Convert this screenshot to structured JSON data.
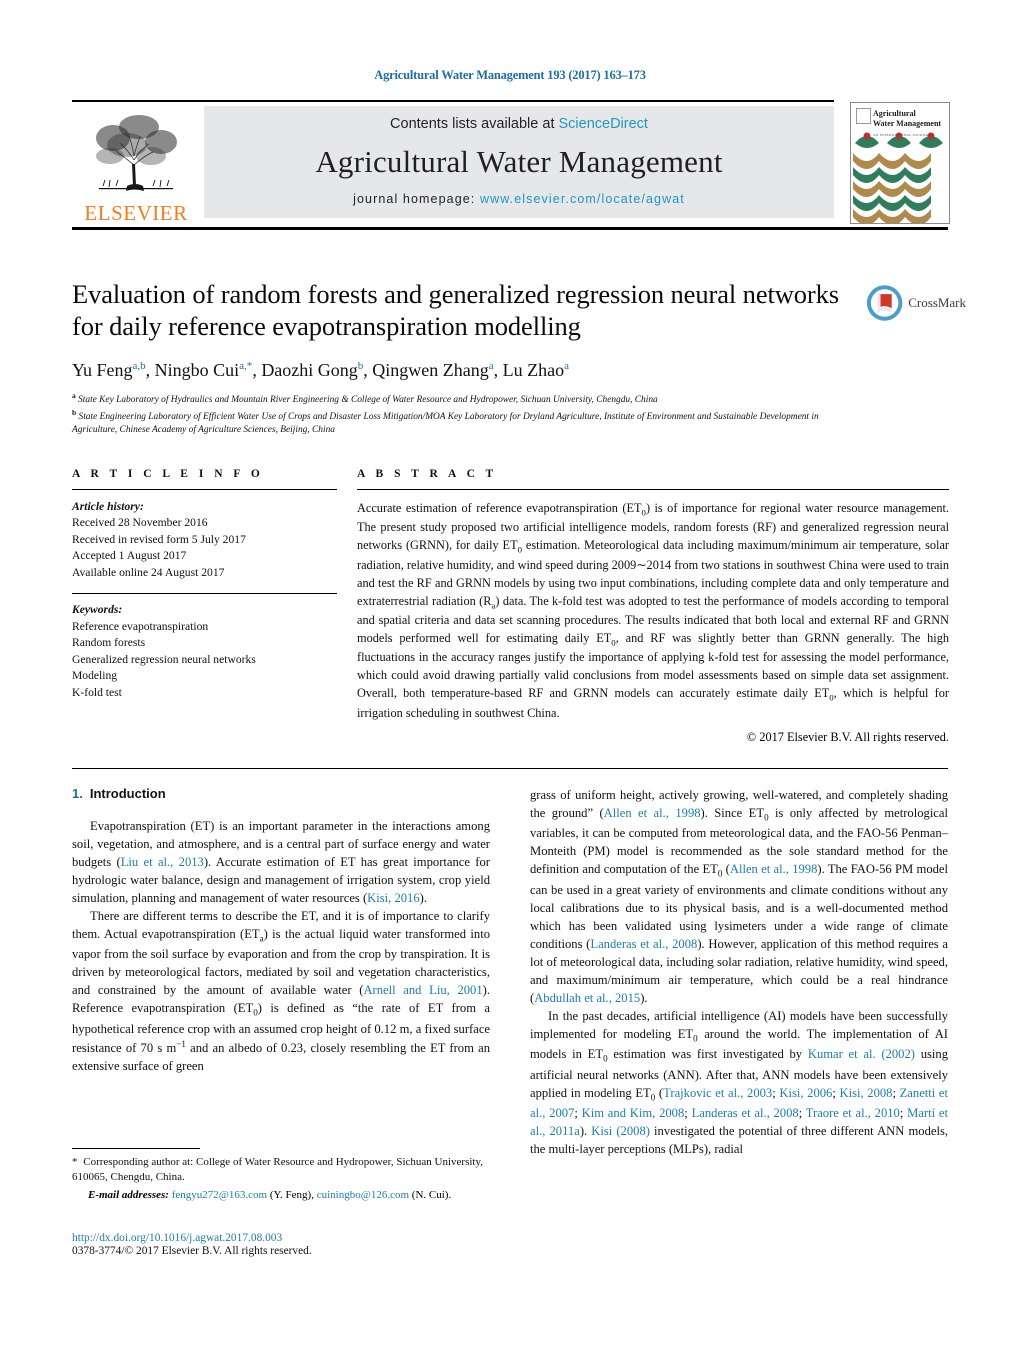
{
  "running_head": "Agricultural Water Management 193 (2017) 163–173",
  "masthead": {
    "contents_prefix": "Contents lists available at ",
    "sciencedirect": "ScienceDirect",
    "journal_title": "Agricultural Water Management",
    "homepage_prefix": "journal homepage: ",
    "homepage_url": "www.elsevier.com/locate/agwat",
    "publisher": "ELSEVIER",
    "cover_title_line1": "Agricultural",
    "cover_title_line2": "Water Management",
    "cover_subtitle": "AN INTERNATIONAL JOURNAL"
  },
  "crossmark": {
    "label": "CrossMark",
    "icon": "crossmark-icon"
  },
  "article": {
    "title": "Evaluation of random forests and generalized regression neural networks for daily reference evapotranspiration modelling",
    "authors_html": "Yu Feng<sup>a,b</sup>, Ningbo Cui<sup>a,*</sup>, Daozhi Gong<sup>b</sup>, Qingwen Zhang<sup>a</sup>, Lu Zhao<sup>a</sup>",
    "affiliation_a": "State Key Laboratory of Hydraulics and Mountain River Engineering & College of Water Resource and Hydropower, Sichuan University, Chengdu, China",
    "affiliation_b": "State Engineering Laboratory of Efficient Water Use of Crops and Disaster Loss Mitigation/MOA Key Laboratory for Dryland Agriculture, Institute of Environment and Sustainable Development in Agriculture, Chinese Academy of Agriculture Sciences, Beijing, China"
  },
  "article_info": {
    "heading": "A R T I C L E   I N F O",
    "history_label": "Article history:",
    "history": [
      "Received 28 November 2016",
      "Received in revised form 5 July 2017",
      "Accepted 1 August 2017",
      "Available online 24 August 2017"
    ],
    "keywords_label": "Keywords:",
    "keywords": [
      "Reference evapotranspiration",
      "Random forests",
      "Generalized regression neural networks",
      "Modeling",
      "K-fold test"
    ]
  },
  "abstract": {
    "heading": "A B S T R A C T",
    "body_html": "Accurate estimation of reference evapotranspiration (ET<sub>0</sub>) is of importance for regional water resource management. The present study proposed two artificial intelligence models, random forests (RF) and generalized regression neural networks (GRNN), for daily ET<sub>0</sub> estimation. Meteorological data including maximum/minimum air temperature, solar radiation, relative humidity, and wind speed during 2009&#8764;2014 from two stations in southwest China were used to train and test the RF and GRNN models by using two input combinations, including complete data and only temperature and extraterrestrial radiation (R<sub>a</sub>) data. The k-fold test was adopted to test the performance of models according to temporal and spatial criteria and data set scanning procedures. The results indicated that both local and external RF and GRNN models performed well for estimating daily ET<sub>0</sub>, and RF was slightly better than GRNN generally. The high fluctuations in the accuracy ranges justify the importance of applying k-fold test for assessing the model performance, which could avoid drawing partially valid conclusions from model assessments based on simple data set assignment. Overall, both temperature-based RF and GRNN models can accurately estimate daily ET<sub>0</sub>, which is helpful for irrigation scheduling in southwest China.",
    "copyright": "© 2017 Elsevier B.V. All rights reserved."
  },
  "introduction": {
    "number": "1.",
    "heading": "Introduction",
    "left_paragraphs_html": [
      "Evapotranspiration (ET) is an important parameter in the interactions among soil, vegetation, and atmosphere, and is a central part of surface energy and water budgets (<span class=\"ref\">Liu et al., 2013</span>). Accurate estimation of ET has great importance for hydrologic water balance, design and management of irrigation system, crop yield simulation, planning and management of water resources (<span class=\"ref\">Kisi, 2016</span>).",
      "There are different terms to describe the ET, and it is of importance to clarify them. Actual evapotranspiration (ET<sub>a</sub>) is the actual liquid water transformed into vapor from the soil surface by evaporation and from the crop by transpiration. It is driven by meteorological factors, mediated by soil and vegetation characteristics, and constrained by the amount of available water (<span class=\"ref\">Arnell and Liu, 2001</span>). Reference evapotranspiration (ET<sub>0</sub>) is defined as &#8220;the rate of ET from a hypothetical reference crop with an assumed crop height of 0.12 m, a fixed surface resistance of 70 s m<sup class=\"inl\">&#8722;1</sup> and an albedo of 0.23, closely resembling the ET from an extensive surface of green"
    ],
    "right_paragraphs_html": [
      "grass of uniform height, actively growing, well-watered, and completely shading the ground&#8221; (<span class=\"ref\">Allen et al., 1998</span>). Since ET<sub>0</sub> is only affected by metrological variables, it can be computed from meteorological data, and the FAO-56 Penman&#8211;Monteith (PM) model is recommended as the sole standard method for the definition and computation of the ET<sub>0</sub> (<span class=\"ref\">Allen et al., 1998</span>). The FAO-56 PM model can be used in a great variety of environments and climate conditions without any local calibrations due to its physical basis, and is a well-documented method which has been validated using lysimeters under a wide range of climate conditions (<span class=\"ref\">Landeras et al., 2008</span>). However, application of this method requires a lot of meteorological data, including solar radiation, relative humidity, wind speed, and maximum/minimum air temperature, which could be a real hindrance (<span class=\"ref\">Abdullah et al., 2015</span>).",
      "In the past decades, artificial intelligence (AI) models have been successfully implemented for modeling ET<sub>0</sub> around the world. The implementation of AI models in ET<sub>0</sub> estimation was first investigated by <span class=\"ref\">Kumar et al. (2002)</span> using artificial neural networks (ANN). After that, ANN models have been extensively applied in modeling ET<sub>0</sub> (<span class=\"ref\">Trajkovic et al., 2003</span>; <span class=\"ref\">Kisi, 2006</span>; <span class=\"ref\">Kisi, 2008</span>; <span class=\"ref\">Zanetti et al., 2007</span>; <span class=\"ref\">Kim and Kim, 2008</span>; <span class=\"ref\">Landeras et al., 2008</span>; <span class=\"ref\">Traore et al., 2010</span>; <span class=\"ref\">Martí et al., 2011a</span>). <span class=\"ref\">Kisi (2008)</span> investigated the potential of three different ANN models, the multi-layer perceptions (MLPs), radial"
    ]
  },
  "footnotes": {
    "corresponding_html": "<span class=\"star\">*</span> Corresponding author at: College of Water Resource and Hydropower, Sichuan University, 610065, Chengdu, China.",
    "email_label": "E-mail addresses:",
    "email_html": " <span class=\"ref\">fengyu272@163.com</span> (Y. Feng), <span class=\"ref\">cuiningbo@126.com</span> (N. Cui).",
    "doi": "http://dx.doi.org/10.1016/j.agwat.2017.08.003",
    "issn_line": "0378-3774/© 2017 Elsevier B.V. All rights reserved."
  },
  "colors": {
    "link": "#1c7cb0",
    "sciencedirect": "#2196c4",
    "elsevier_orange": "#f47c20",
    "band_gray": "#e6e7e9"
  }
}
